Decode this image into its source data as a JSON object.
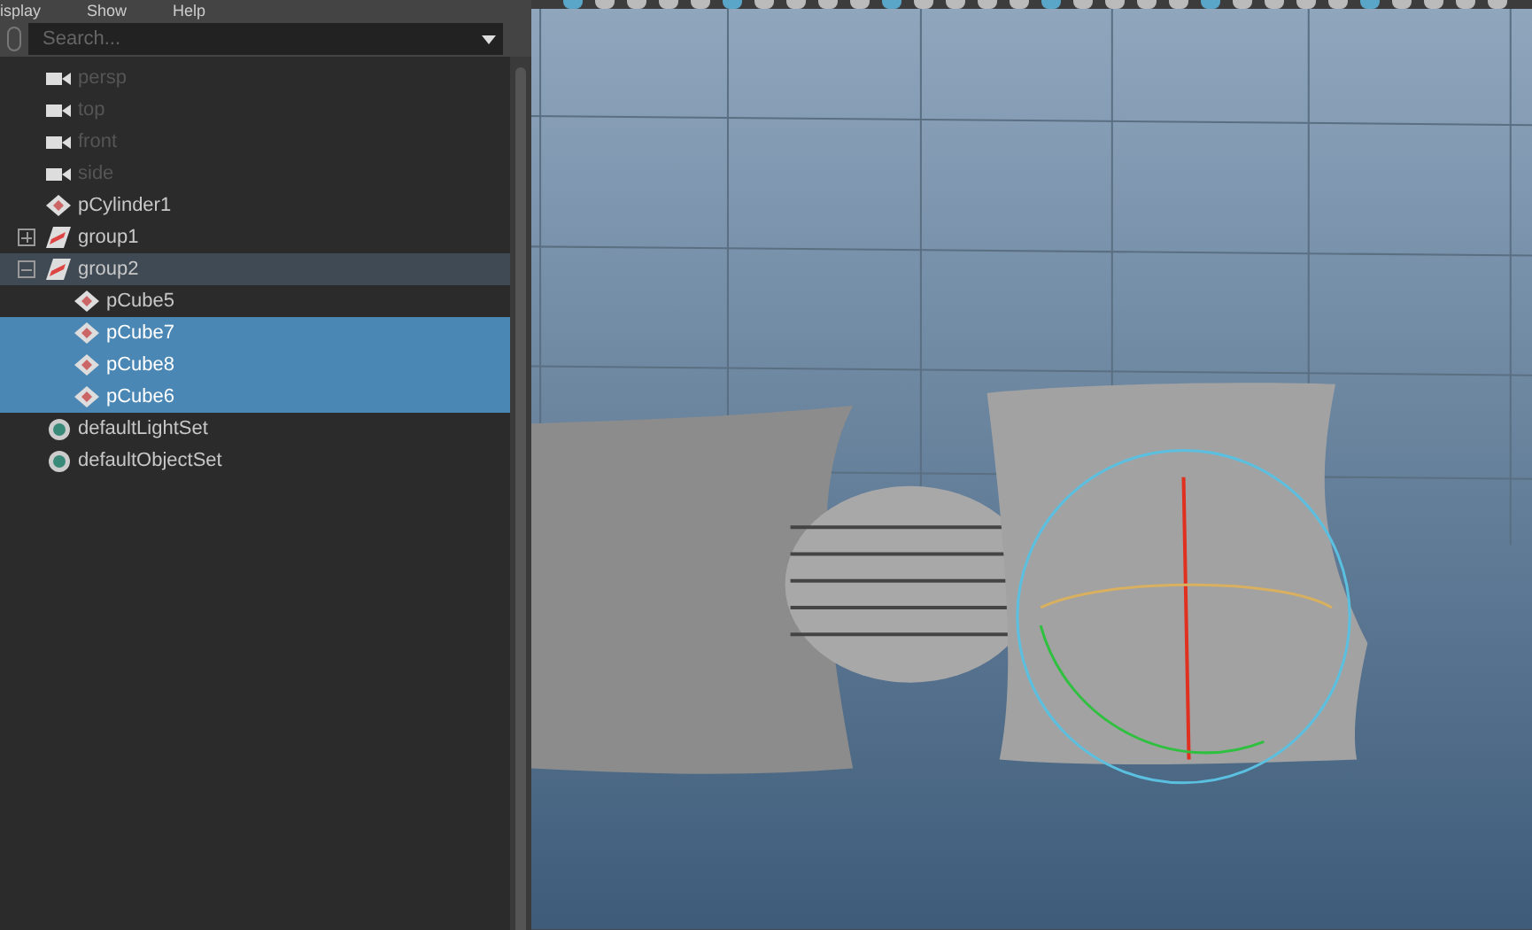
{
  "menu": [
    "isplay",
    "Show",
    "Help"
  ],
  "search": {
    "placeholder": "Search..."
  },
  "outliner": {
    "items": [
      {
        "label": "persp",
        "kind": "camera",
        "dim": true,
        "selected": false,
        "highlighted": false
      },
      {
        "label": "top",
        "kind": "camera",
        "dim": true,
        "selected": false,
        "highlighted": false
      },
      {
        "label": "front",
        "kind": "camera",
        "dim": true,
        "selected": false,
        "highlighted": false
      },
      {
        "label": "side",
        "kind": "camera",
        "dim": true,
        "selected": false,
        "highlighted": false
      },
      {
        "label": "pCylinder1",
        "kind": "mesh",
        "dim": false,
        "selected": false,
        "highlighted": false
      },
      {
        "label": "group1",
        "kind": "group",
        "dim": false,
        "selected": false,
        "highlighted": false,
        "expanded": false
      },
      {
        "label": "group2",
        "kind": "group",
        "dim": false,
        "selected": false,
        "highlighted": true,
        "expanded": true,
        "children": [
          {
            "label": "pCube5",
            "kind": "mesh",
            "dim": false,
            "selected": false,
            "highlighted": false
          },
          {
            "label": "pCube7",
            "kind": "mesh",
            "dim": false,
            "selected": true,
            "highlighted": false
          },
          {
            "label": "pCube8",
            "kind": "mesh",
            "dim": false,
            "selected": true,
            "highlighted": false
          },
          {
            "label": "pCube6",
            "kind": "mesh",
            "dim": false,
            "selected": true,
            "highlighted": false
          }
        ]
      },
      {
        "label": "defaultLightSet",
        "kind": "set",
        "dim": false,
        "selected": false,
        "highlighted": false
      },
      {
        "label": "defaultObjectSet",
        "kind": "set",
        "dim": false,
        "selected": false,
        "highlighted": false
      }
    ]
  }
}
